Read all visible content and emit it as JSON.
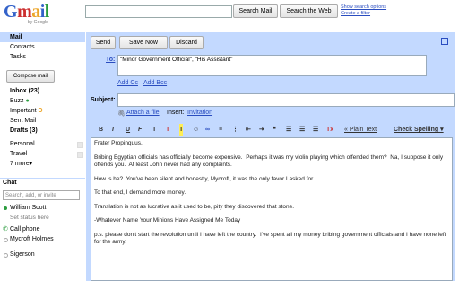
{
  "logo": {
    "g": "G",
    "m": "m",
    "a": "a",
    "i": "i",
    "l": "l",
    "by": "by Google"
  },
  "header": {
    "search_mail": "Search Mail",
    "search_web": "Search the Web",
    "show_options": "Show search options",
    "create_filter": "Create a filter"
  },
  "sidebar": {
    "mail": "Mail",
    "contacts": "Contacts",
    "tasks": "Tasks",
    "compose": "Compose mail",
    "inbox": "Inbox (23)",
    "buzz": "Buzz",
    "important": "Important",
    "sent": "Sent Mail",
    "drafts": "Drafts (3)",
    "personal": "Personal",
    "travel": "Travel",
    "more": "7 more▾"
  },
  "chat": {
    "title": "Chat",
    "search_placeholder": "Search, add, or invite",
    "me": "William Scott",
    "status": "Set status here",
    "call": "Call phone",
    "contacts": [
      "Mycroft Holmes",
      "Sigerson"
    ]
  },
  "composeBar": {
    "send": "Send",
    "save": "Save Now",
    "discard": "Discard"
  },
  "to": {
    "label": "To:",
    "value": "\"Minor Government Official\", \"His Assistant\""
  },
  "addCc": "Add Cc",
  "addBcc": "Add Bcc",
  "subject": {
    "label": "Subject:",
    "value": ""
  },
  "attach": "Attach a file",
  "insert": "Insert:",
  "invitation": "Invitation",
  "plainText": "« Plain Text",
  "checkSpelling": "Check Spelling ▾",
  "body": [
    "Frater Propinquus,",
    "Bribing Egyptian officials has officially become expensive.  Perhaps it was my violin playing which offended them?  Na, I suppose it only offends you.  At least John never had any complaints.",
    "How is he?  You've been silent and honestly, Mycroft, it was the only favor I asked for.",
    "To that end, I demand more money.",
    "Translation is not as lucrative as it used to be, pity they discovered that stone.",
    "-Whatever Name Your Minions Have Assigned Me Today",
    "p.s. please don't start the revolution until I have left the country.  I've spent all my money bribing government officials and I have none left for the army."
  ]
}
